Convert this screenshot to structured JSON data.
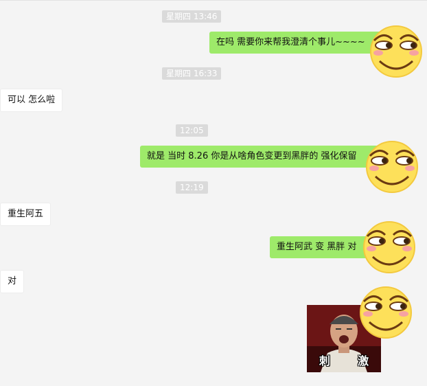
{
  "timestamps": [
    "星期四 13:46",
    "星期四 16:33",
    "12:05",
    "12:19"
  ],
  "messages": [
    {
      "side": "right",
      "text": "在吗  需要你来帮我澄清个事儿~~~~"
    },
    {
      "side": "left",
      "text": "可以 怎么啦"
    },
    {
      "side": "right",
      "text": "就是 当时 8.26  你是从啥角色变更到黑胖的  强化保留"
    },
    {
      "side": "left",
      "text": "重生阿五"
    },
    {
      "side": "right",
      "text": "重生阿武 变 黑胖 对"
    },
    {
      "side": "left",
      "text": "对"
    }
  ],
  "sticker": {
    "caption_left": "刺",
    "caption_right": "激"
  },
  "colors": {
    "background": "#f4f4f4",
    "right_bubble": "#9eea6a",
    "left_bubble": "#ffffff",
    "timestamp_bg": "#dadada"
  },
  "icons": [
    "smirk-emoji-icon"
  ]
}
